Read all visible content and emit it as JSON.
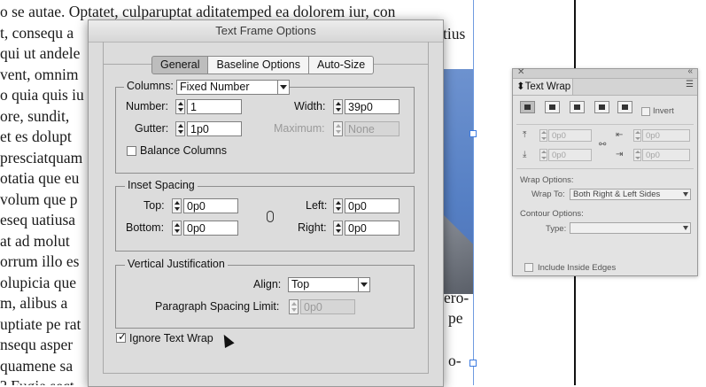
{
  "document": {
    "lines": [
      "o se autae. Optatet, culparuptat aditatemped ea dolorem iur, con",
      "t, consequ a",
      "qui ut andele",
      "vent, omnim",
      "o quia quis iu",
      "ore, sundit,",
      "et es dolupt",
      "presciatquam",
      "otatia que eu",
      "volum que p",
      "eseq uatiusa",
      "at ad molut",
      "orrum illo es",
      "olupicia que",
      "m, alibus a",
      "uptiate pe rat",
      "nsequ asper",
      "quamene sa",
      "? Fugia sect"
    ],
    "right_fragments": [
      "tius",
      "ero-",
      "pe",
      "o-"
    ]
  },
  "dialog": {
    "title": "Text Frame Options",
    "tabs": [
      {
        "label": "General",
        "active": true
      },
      {
        "label": "Baseline Options",
        "active": false
      },
      {
        "label": "Auto-Size",
        "active": false
      }
    ],
    "columns": {
      "label": "Columns:",
      "mode": "Fixed Number",
      "number_label": "Number:",
      "number": "1",
      "width_label": "Width:",
      "width": "39p0",
      "gutter_label": "Gutter:",
      "gutter": "1p0",
      "maximum_label": "Maximum:",
      "maximum": "None",
      "balance_label": "Balance Columns",
      "balance_checked": false
    },
    "inset": {
      "label": "Inset Spacing",
      "top_label": "Top:",
      "top": "0p0",
      "bottom_label": "Bottom:",
      "bottom": "0p0",
      "left_label": "Left:",
      "left": "0p0",
      "right_label": "Right:",
      "right": "0p0"
    },
    "vertical": {
      "label": "Vertical Justification",
      "align_label": "Align:",
      "align": "Top",
      "spacing_label": "Paragraph Spacing Limit:",
      "spacing": "0p0"
    },
    "ignore_wrap_label": "Ignore Text Wrap",
    "ignore_wrap_checked": true
  },
  "panel": {
    "title": "Text Wrap",
    "invert_label": "Invert",
    "offsets": {
      "top": "0p0",
      "bottom": "0p0",
      "left": "0p0",
      "right": "0p0"
    },
    "wrap_options_label": "Wrap Options:",
    "wrap_to_label": "Wrap To:",
    "wrap_to": "Both Right & Left Sides",
    "contour_options_label": "Contour Options:",
    "type_label": "Type:",
    "type": "",
    "include_inside_edges_label": "Include Inside Edges"
  },
  "colors": {
    "dialog_bg": "#dcdcdc",
    "panel_bg": "#e3e3e3",
    "image_blue": "#557fc4",
    "selection_blue": "#3d7be0"
  }
}
